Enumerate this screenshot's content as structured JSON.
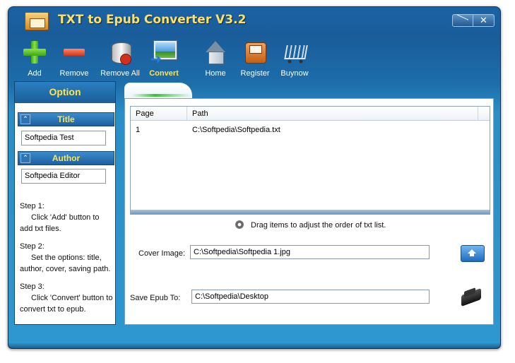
{
  "window": {
    "title": "TXT to Epub Converter V3.2"
  },
  "toolbar": {
    "items": [
      {
        "label": "Add",
        "icon": "add-icon"
      },
      {
        "label": "Remove",
        "icon": "remove-icon"
      },
      {
        "label": "Remove All",
        "icon": "remove-all-icon"
      },
      {
        "label": "Convert",
        "icon": "convert-icon",
        "active": true
      },
      {
        "label": "Home",
        "icon": "home-icon"
      },
      {
        "label": "Register",
        "icon": "register-icon"
      },
      {
        "label": "Buynow",
        "icon": "cart-icon"
      }
    ]
  },
  "options": {
    "header": "Option",
    "title_label": "Title",
    "title_value": "Softpedia Test",
    "author_label": "Author",
    "author_value": "Softpedia Editor",
    "steps": [
      {
        "heading": "Step 1:",
        "text": "Click 'Add' button to",
        "text2": "add txt files."
      },
      {
        "heading": "Step 2:",
        "text": "Set the options: title,",
        "text2": "author, cover, saving path."
      },
      {
        "heading": "Step 3:",
        "text": "Click 'Convert' button to",
        "text2": "convert txt to epub."
      }
    ]
  },
  "files": {
    "columns": [
      "Page",
      "Path"
    ],
    "rows": [
      {
        "page": "1",
        "path": "C:\\Softpedia\\Softpedia.txt"
      }
    ]
  },
  "hint": "Drag items to  adjust the order of txt list.",
  "cover": {
    "label": "Cover Image:",
    "value": "C:\\Softpedia\\Softpedia 1.jpg"
  },
  "save": {
    "label": "Save Epub To:",
    "value": "C:\\Softpedia\\Desktop"
  },
  "colors": {
    "accent": "#ffe54d",
    "frame": "#1d6eab"
  }
}
